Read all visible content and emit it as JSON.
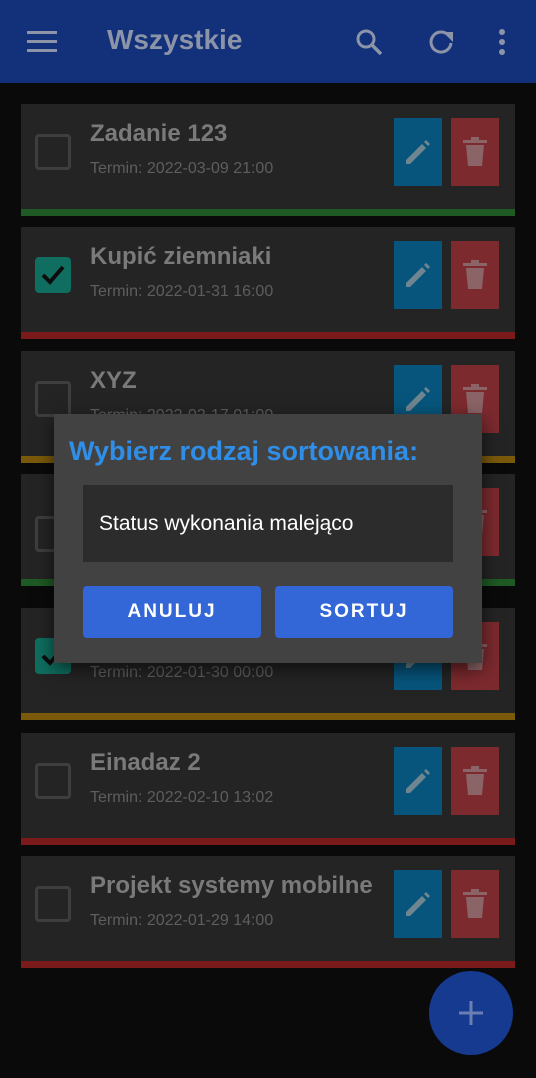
{
  "appbar": {
    "title": "Wszystkie",
    "menu_icon": "hamburger-menu-icon",
    "search_icon": "search-icon",
    "refresh_icon": "refresh-icon",
    "overflow_icon": "more-vert-icon"
  },
  "tasks": [
    {
      "title": "Zadanie 123",
      "due": "Termin: 2022-03-09 21:00",
      "done": false,
      "priority_color": "#2e7d32"
    },
    {
      "title": "Kupić ziemniaki",
      "due": "Termin: 2022-01-31 16:00",
      "done": true,
      "priority_color": "#b71c1c"
    },
    {
      "title": "XYZ",
      "due": "Termin: 2022-02-17 01:00",
      "done": false,
      "priority_color": "#b8860b"
    },
    {
      "title": "",
      "due": "",
      "done": false,
      "priority_color": "#2e7d32"
    },
    {
      "title": "",
      "due": "Termin: 2022-01-30 00:00",
      "done": true,
      "priority_color": "#b8860b"
    },
    {
      "title": "Einadaz 2",
      "due": "Termin: 2022-02-10 13:02",
      "done": false,
      "priority_color": "#b71c1c"
    },
    {
      "title": "Projekt systemy mobilne",
      "due": "Termin: 2022-01-29 14:00",
      "done": false,
      "priority_color": "#b71c1c"
    }
  ],
  "dialog": {
    "title": "Wybierz rodzaj sortowania:",
    "selected_option": "Status wykonania malejąco",
    "cancel_label": "ANULUJ",
    "confirm_label": "SORTUJ"
  },
  "fab": {
    "icon": "plus-icon"
  },
  "colors": {
    "appbar": "#1a44b3",
    "accent": "#2f8fe8",
    "button": "#3366d6",
    "edit": "#0a7dbf",
    "delete": "#c0393f"
  }
}
